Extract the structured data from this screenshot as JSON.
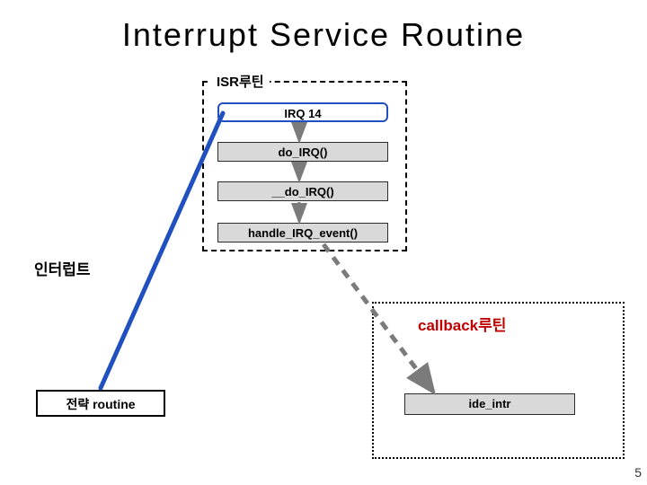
{
  "title": "Interrupt Service Routine",
  "isr": {
    "group_label": "ISR루틴",
    "irq14": "IRQ 14",
    "do_irq": "do_IRQ()",
    "do_irq2": "__do_IRQ()",
    "handle": "handle_IRQ_event()"
  },
  "interrupt_label": "인터럽트",
  "callback": {
    "group_label": "callback루틴",
    "ide_intr": "ide_intr"
  },
  "strategy_label": "전략 routine",
  "page_number": "5",
  "colors": {
    "blue": "#2050c0",
    "red": "#c00000",
    "arrow_gray": "#7b7b7b"
  }
}
